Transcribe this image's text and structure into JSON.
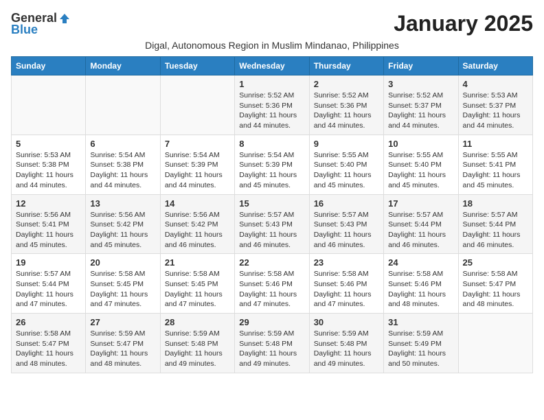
{
  "header": {
    "logo_general": "General",
    "logo_blue": "Blue",
    "month_title": "January 2025",
    "subtitle": "Digal, Autonomous Region in Muslim Mindanao, Philippines"
  },
  "columns": [
    "Sunday",
    "Monday",
    "Tuesday",
    "Wednesday",
    "Thursday",
    "Friday",
    "Saturday"
  ],
  "weeks": [
    [
      {
        "day": "",
        "content": ""
      },
      {
        "day": "",
        "content": ""
      },
      {
        "day": "",
        "content": ""
      },
      {
        "day": "1",
        "content": "Sunrise: 5:52 AM\nSunset: 5:36 PM\nDaylight: 11 hours and 44 minutes."
      },
      {
        "day": "2",
        "content": "Sunrise: 5:52 AM\nSunset: 5:36 PM\nDaylight: 11 hours and 44 minutes."
      },
      {
        "day": "3",
        "content": "Sunrise: 5:52 AM\nSunset: 5:37 PM\nDaylight: 11 hours and 44 minutes."
      },
      {
        "day": "4",
        "content": "Sunrise: 5:53 AM\nSunset: 5:37 PM\nDaylight: 11 hours and 44 minutes."
      }
    ],
    [
      {
        "day": "5",
        "content": "Sunrise: 5:53 AM\nSunset: 5:38 PM\nDaylight: 11 hours and 44 minutes."
      },
      {
        "day": "6",
        "content": "Sunrise: 5:54 AM\nSunset: 5:38 PM\nDaylight: 11 hours and 44 minutes."
      },
      {
        "day": "7",
        "content": "Sunrise: 5:54 AM\nSunset: 5:39 PM\nDaylight: 11 hours and 44 minutes."
      },
      {
        "day": "8",
        "content": "Sunrise: 5:54 AM\nSunset: 5:39 PM\nDaylight: 11 hours and 45 minutes."
      },
      {
        "day": "9",
        "content": "Sunrise: 5:55 AM\nSunset: 5:40 PM\nDaylight: 11 hours and 45 minutes."
      },
      {
        "day": "10",
        "content": "Sunrise: 5:55 AM\nSunset: 5:40 PM\nDaylight: 11 hours and 45 minutes."
      },
      {
        "day": "11",
        "content": "Sunrise: 5:55 AM\nSunset: 5:41 PM\nDaylight: 11 hours and 45 minutes."
      }
    ],
    [
      {
        "day": "12",
        "content": "Sunrise: 5:56 AM\nSunset: 5:41 PM\nDaylight: 11 hours and 45 minutes."
      },
      {
        "day": "13",
        "content": "Sunrise: 5:56 AM\nSunset: 5:42 PM\nDaylight: 11 hours and 45 minutes."
      },
      {
        "day": "14",
        "content": "Sunrise: 5:56 AM\nSunset: 5:42 PM\nDaylight: 11 hours and 46 minutes."
      },
      {
        "day": "15",
        "content": "Sunrise: 5:57 AM\nSunset: 5:43 PM\nDaylight: 11 hours and 46 minutes."
      },
      {
        "day": "16",
        "content": "Sunrise: 5:57 AM\nSunset: 5:43 PM\nDaylight: 11 hours and 46 minutes."
      },
      {
        "day": "17",
        "content": "Sunrise: 5:57 AM\nSunset: 5:44 PM\nDaylight: 11 hours and 46 minutes."
      },
      {
        "day": "18",
        "content": "Sunrise: 5:57 AM\nSunset: 5:44 PM\nDaylight: 11 hours and 46 minutes."
      }
    ],
    [
      {
        "day": "19",
        "content": "Sunrise: 5:57 AM\nSunset: 5:44 PM\nDaylight: 11 hours and 47 minutes."
      },
      {
        "day": "20",
        "content": "Sunrise: 5:58 AM\nSunset: 5:45 PM\nDaylight: 11 hours and 47 minutes."
      },
      {
        "day": "21",
        "content": "Sunrise: 5:58 AM\nSunset: 5:45 PM\nDaylight: 11 hours and 47 minutes."
      },
      {
        "day": "22",
        "content": "Sunrise: 5:58 AM\nSunset: 5:46 PM\nDaylight: 11 hours and 47 minutes."
      },
      {
        "day": "23",
        "content": "Sunrise: 5:58 AM\nSunset: 5:46 PM\nDaylight: 11 hours and 47 minutes."
      },
      {
        "day": "24",
        "content": "Sunrise: 5:58 AM\nSunset: 5:46 PM\nDaylight: 11 hours and 48 minutes."
      },
      {
        "day": "25",
        "content": "Sunrise: 5:58 AM\nSunset: 5:47 PM\nDaylight: 11 hours and 48 minutes."
      }
    ],
    [
      {
        "day": "26",
        "content": "Sunrise: 5:58 AM\nSunset: 5:47 PM\nDaylight: 11 hours and 48 minutes."
      },
      {
        "day": "27",
        "content": "Sunrise: 5:59 AM\nSunset: 5:47 PM\nDaylight: 11 hours and 48 minutes."
      },
      {
        "day": "28",
        "content": "Sunrise: 5:59 AM\nSunset: 5:48 PM\nDaylight: 11 hours and 49 minutes."
      },
      {
        "day": "29",
        "content": "Sunrise: 5:59 AM\nSunset: 5:48 PM\nDaylight: 11 hours and 49 minutes."
      },
      {
        "day": "30",
        "content": "Sunrise: 5:59 AM\nSunset: 5:48 PM\nDaylight: 11 hours and 49 minutes."
      },
      {
        "day": "31",
        "content": "Sunrise: 5:59 AM\nSunset: 5:49 PM\nDaylight: 11 hours and 50 minutes."
      },
      {
        "day": "",
        "content": ""
      }
    ]
  ]
}
